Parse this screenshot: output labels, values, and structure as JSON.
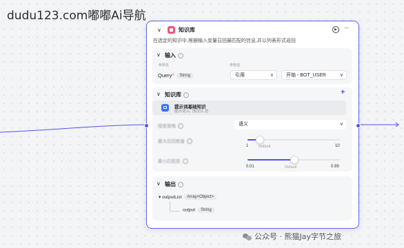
{
  "watermark_top": "dudu123.com嘟嘟Ai导航",
  "node": {
    "title": "知识库",
    "description": "在选定的知识中,根据输入变量召回最匹配的信息,并以列表形式返回",
    "icon": "knowledge-icon"
  },
  "input_section": {
    "title": "输入",
    "col_name_label": "参数名",
    "col_value_label": "参数值",
    "param_name": "Query",
    "required_mark": "*",
    "param_type": "String",
    "value_mode": "引用",
    "value_ref": "开始 - BOT_USER"
  },
  "knowledge_section": {
    "title": "知识库",
    "item_name": "提示词基础知识",
    "item_desc": "提示词入门知识汇总",
    "search_strategy_label": "搜索策略",
    "search_strategy_value": "语义",
    "max_recall_label": "最大召回数量",
    "max_recall_min": "1",
    "max_recall_default": "Default",
    "max_recall_max": "10",
    "max_recall_value": 0.13,
    "min_match_label": "最小匹配度",
    "min_match_min": "0.01",
    "min_match_default": "Default",
    "min_match_max": "0.99",
    "min_match_value": 0.5
  },
  "output_section": {
    "title": "输出",
    "output_list_name": "outputList",
    "output_list_type": "Array<Object>",
    "output_child_name": "output",
    "output_child_type": "String"
  },
  "footer_watermark": "公众号 · 熊猫Jay字节之旅",
  "colors": {
    "accent": "#4d53e8",
    "node_icon": "#f0517a",
    "kb_icon": "#3b72f6",
    "required": "#e5484d"
  }
}
